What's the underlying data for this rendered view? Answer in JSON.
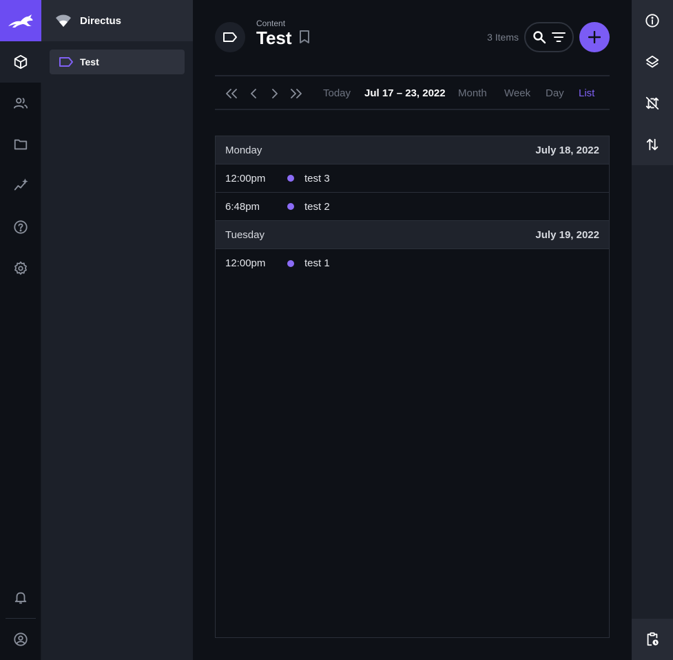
{
  "project": {
    "name": "Directus"
  },
  "nav": {
    "items": [
      {
        "label": "Test"
      }
    ]
  },
  "header": {
    "breadcrumb": "Content",
    "title": "Test",
    "item_count": "3 Items"
  },
  "toolbar": {
    "range": "Jul 17 – 23, 2022",
    "today": "Today",
    "views": [
      "Month",
      "Week",
      "Day",
      "List"
    ],
    "active_view": "List"
  },
  "days": [
    {
      "name": "Monday",
      "date": "July 18, 2022",
      "events": [
        {
          "time": "12:00pm",
          "title": "test 3"
        },
        {
          "time": "6:48pm",
          "title": "test 2"
        }
      ]
    },
    {
      "name": "Tuesday",
      "date": "July 19, 2022",
      "events": [
        {
          "time": "12:00pm",
          "title": "test 1"
        }
      ]
    }
  ],
  "colors": {
    "accent": "#7b5cf5",
    "event_dot": "#8b6cf6",
    "background": "#0e1117",
    "sidebar": "#1c2029"
  },
  "icons": {
    "module_bar": [
      "content-box-icon",
      "users-icon",
      "folder-icon",
      "insights-icon",
      "help-icon",
      "settings-icon",
      "notifications-icon",
      "account-icon"
    ],
    "right_bar": [
      "info-icon",
      "layers-icon",
      "sync-disabled-icon",
      "import-export-icon",
      "activity-clipboard-icon"
    ]
  }
}
